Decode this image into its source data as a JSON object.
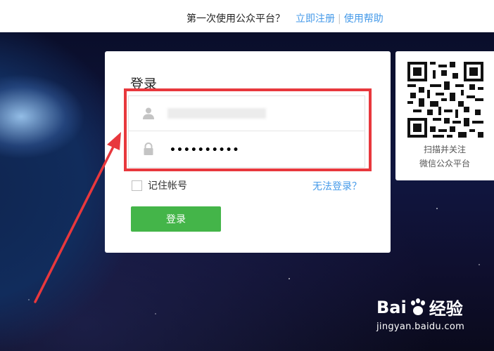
{
  "topbar": {
    "question": "第一次使用公众平台？",
    "register_link": "立即注册",
    "separator": "|",
    "help_link": "使用帮助"
  },
  "login": {
    "title": "登录",
    "password_masked": "••••••••••",
    "remember_label": "记住帐号",
    "cant_login_link": "无法登录？",
    "submit_label": "登录"
  },
  "qr": {
    "line1": "扫描并关注",
    "line2": "微信公众平台"
  },
  "watermark": {
    "brand_left": "Bai",
    "brand_right": "经验",
    "url": "jingyan.baidu.com"
  },
  "colors": {
    "link": "#459ae9",
    "primary_button": "#44b549",
    "highlight_box": "#e8383d"
  }
}
